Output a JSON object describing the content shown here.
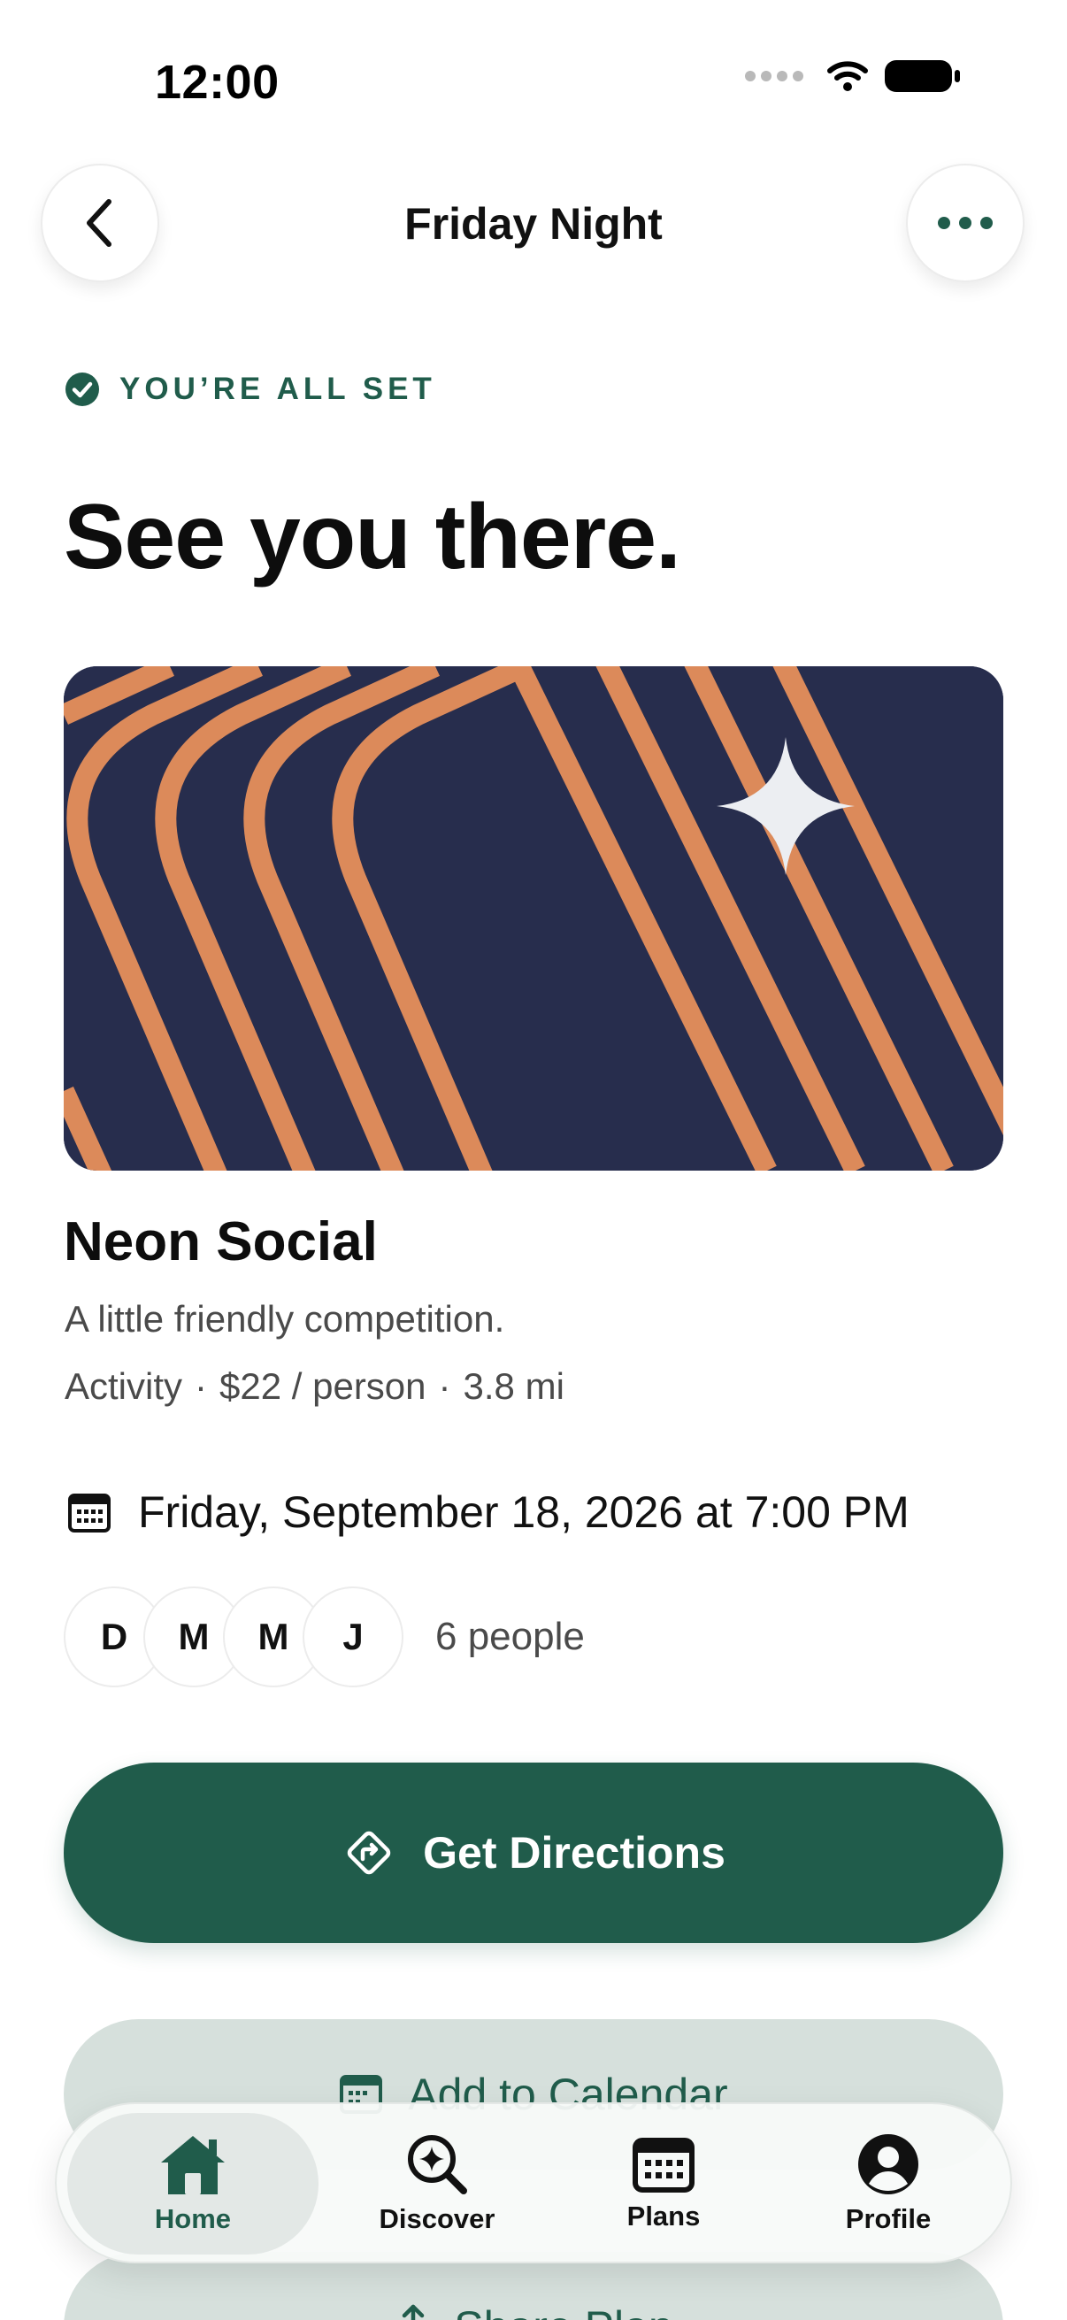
{
  "status_bar": {
    "time": "12:00"
  },
  "nav": {
    "title": "Friday Night"
  },
  "confirmation": {
    "label": "YOU’RE ALL SET"
  },
  "headline": "See you there.",
  "venue": {
    "name": "Neon Social",
    "tagline": "A little friendly competition.",
    "category": "Activity",
    "price": "$22 / person",
    "distance": "3.8 mi",
    "separator": "·"
  },
  "event": {
    "datetime": "Friday, September 18, 2026 at 7:00 PM"
  },
  "attendees": {
    "initials": [
      "D",
      "M",
      "M",
      "J"
    ],
    "count_label": "6 people"
  },
  "actions": {
    "directions": "Get Directions",
    "calendar": "Add to Calendar",
    "share": "Share Plan"
  },
  "tabs": [
    {
      "label": "Home",
      "icon": "home-icon",
      "active": true
    },
    {
      "label": "Discover",
      "icon": "discover-icon",
      "active": false
    },
    {
      "label": "Plans",
      "icon": "calendar-icon",
      "active": false
    },
    {
      "label": "Profile",
      "icon": "profile-icon",
      "active": false
    }
  ],
  "colors": {
    "brand": "#205c4b",
    "hero_background": "#272d4d",
    "hero_stripes": "#dc8a5a",
    "secondary_button": "#d6e0dc"
  }
}
